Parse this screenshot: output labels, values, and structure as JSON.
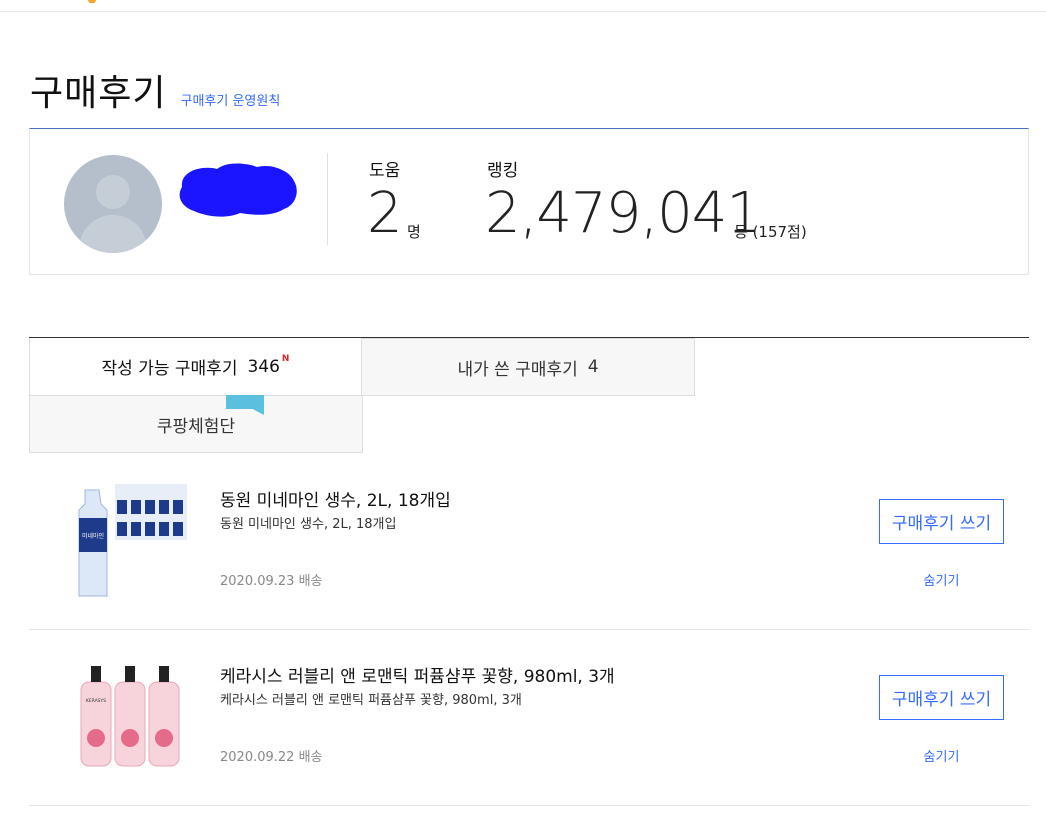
{
  "header": {
    "title": "구매후기",
    "policy_link": "구매후기 운영원칙"
  },
  "profile": {
    "help_label": "도움",
    "help_value": "2",
    "help_unit": "명",
    "rank_label": "랭킹",
    "rank_value": "2,479,041",
    "rank_unit": "등 (157점)"
  },
  "tabs": [
    {
      "label": "작성 가능 구매후기",
      "count": "346",
      "badge": "N"
    },
    {
      "label": "내가 쓴 구매후기",
      "count": "4"
    },
    {
      "label": "쿠팡체험단"
    }
  ],
  "items": [
    {
      "title": "동원 미네마인 생수, 2L, 18개입",
      "subtitle": "동원 미네마인 생수, 2L, 18개입",
      "date": "2020.09.23 배송",
      "write_label": "구매후기 쓰기",
      "hide_label": "숨기기",
      "thumb_label": "미네마인"
    },
    {
      "title": "케라시스 러블리 앤 로맨틱 퍼퓸샴푸 꽃향, 980ml, 3개",
      "subtitle": "케라시스 러블리 앤 로맨틱 퍼퓸샴푸 꽃향, 980ml, 3개",
      "date": "2020.09.22 배송",
      "write_label": "구매후기 쓰기",
      "hide_label": "숨기기",
      "thumb_label": "KERASYS"
    }
  ],
  "colors": {
    "accent": "#346aff",
    "badge": "#e52528",
    "redaction": "#1a14ff"
  }
}
